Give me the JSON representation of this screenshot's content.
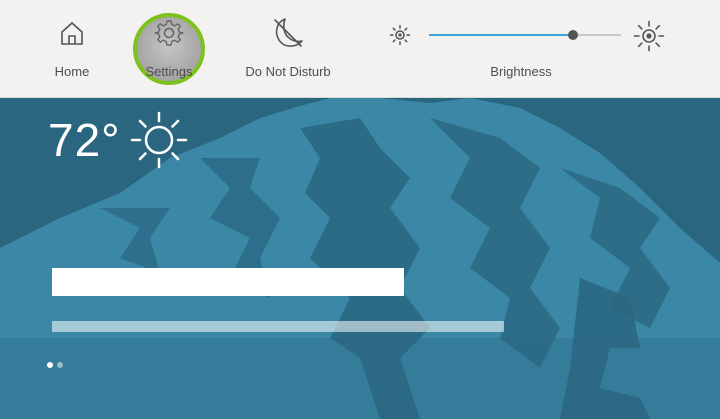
{
  "quick_actions": {
    "home_label": "Home",
    "settings_label": "Settings",
    "dnd_label": "Do Not Disturb",
    "home_icon": "home-icon",
    "settings_icon": "gear-icon",
    "dnd_icon": "moon-icon"
  },
  "brightness": {
    "label": "Brightness",
    "level": 0.75,
    "min_icon": "sun-small-icon",
    "max_icon": "sun-large-icon"
  },
  "weather": {
    "temperature": "72°",
    "icon": "sun-icon"
  },
  "carousel": {
    "page_count": 2,
    "active_page": 1
  },
  "colors": {
    "highlight_ring": "#7dc21f",
    "slider_fill": "#3aa6e0",
    "background": "#2a6680"
  }
}
